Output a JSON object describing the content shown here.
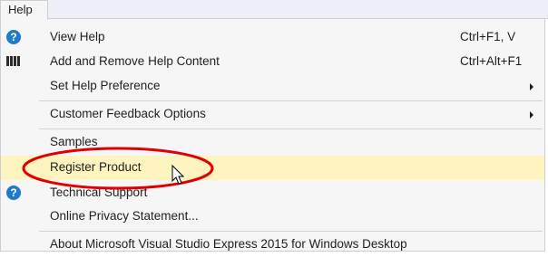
{
  "menubar": {
    "menu_title": "Help"
  },
  "menu": {
    "items": [
      {
        "label": "View Help",
        "shortcut": "Ctrl+F1, V",
        "icon": "help-icon"
      },
      {
        "label": "Add and Remove Help Content",
        "shortcut": "Ctrl+Alt+F1",
        "icon": "books-icon"
      },
      {
        "label": "Set Help Preference",
        "submenu": true
      },
      {
        "label": "Customer Feedback Options",
        "submenu": true
      },
      {
        "label": "Samples"
      },
      {
        "label": "Register Product",
        "highlighted": true
      },
      {
        "label": "Technical Support",
        "icon": "help-icon"
      },
      {
        "label": "Online Privacy Statement..."
      },
      {
        "label": "About Microsoft Visual Studio Express 2015 for Windows Desktop"
      }
    ]
  },
  "colors": {
    "highlight": "#fdf4bf",
    "annotation_circle": "#e00000",
    "help_icon": "#1e7bcc",
    "menu_background": "#f6f6f6"
  },
  "annotation": {
    "shape": "red-ellipse",
    "target": "Register Product"
  },
  "cursor": {
    "type": "arrow-pointer"
  }
}
